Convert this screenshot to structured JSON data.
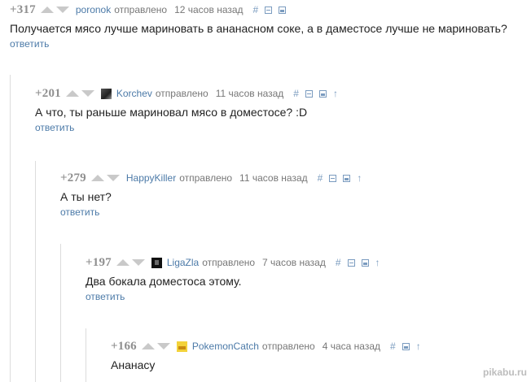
{
  "comments": [
    {
      "rating": "+317",
      "username": "poronok",
      "sent_label": "отправлено",
      "time_ago": "12 часов назад",
      "text": "Получается мясо лучше мариновать в ананасном соке, а в даместосе лучше не мариновать?",
      "reply_label": "ответить",
      "icons": [
        "arrow-up-icon",
        "arrow-down-icon",
        "hash-icon",
        "collapse-icon",
        "save-icon"
      ]
    },
    {
      "rating": "+201",
      "username": "Korchev",
      "sent_label": "отправлено",
      "time_ago": "11 часов назад",
      "text": "А что, ты раньше мариновал мясо в доместосе? :D",
      "reply_label": "ответить",
      "icons": [
        "arrow-up-icon",
        "arrow-down-icon",
        "avatar",
        "hash-icon",
        "collapse-icon",
        "save-icon",
        "parent-arrow-icon"
      ]
    },
    {
      "rating": "+279",
      "username": "HappyKiller",
      "sent_label": "отправлено",
      "time_ago": "11 часов назад",
      "text": "А ты нет?",
      "reply_label": "ответить",
      "icons": [
        "arrow-up-icon",
        "arrow-down-icon",
        "hash-icon",
        "collapse-icon",
        "save-icon",
        "parent-arrow-icon"
      ]
    },
    {
      "rating": "+197",
      "username": "LigaZla",
      "sent_label": "отправлено",
      "time_ago": "7 часов назад",
      "text": "Два бокала доместоса этому.",
      "reply_label": "ответить",
      "icons": [
        "arrow-up-icon",
        "arrow-down-icon",
        "avatar",
        "hash-icon",
        "collapse-icon",
        "save-icon",
        "parent-arrow-icon"
      ]
    },
    {
      "rating": "+166",
      "username": "PokemonCatch",
      "sent_label": "отправлено",
      "time_ago": "4 часа назад",
      "text": "Ананасу",
      "icons": [
        "arrow-up-icon",
        "arrow-down-icon",
        "avatar",
        "hash-icon",
        "save-icon",
        "parent-arrow-icon"
      ]
    }
  ],
  "glyphs": {
    "hash": "#",
    "parent_arrow": "↑"
  },
  "watermark": "pikabu.ru",
  "colors": {
    "username": "#4c7aa8",
    "icon": "#7a9bbf",
    "rating": "#8f8f8f",
    "vote_arrow": "#c9c9c9",
    "thread_line": "#dcdcdc"
  }
}
